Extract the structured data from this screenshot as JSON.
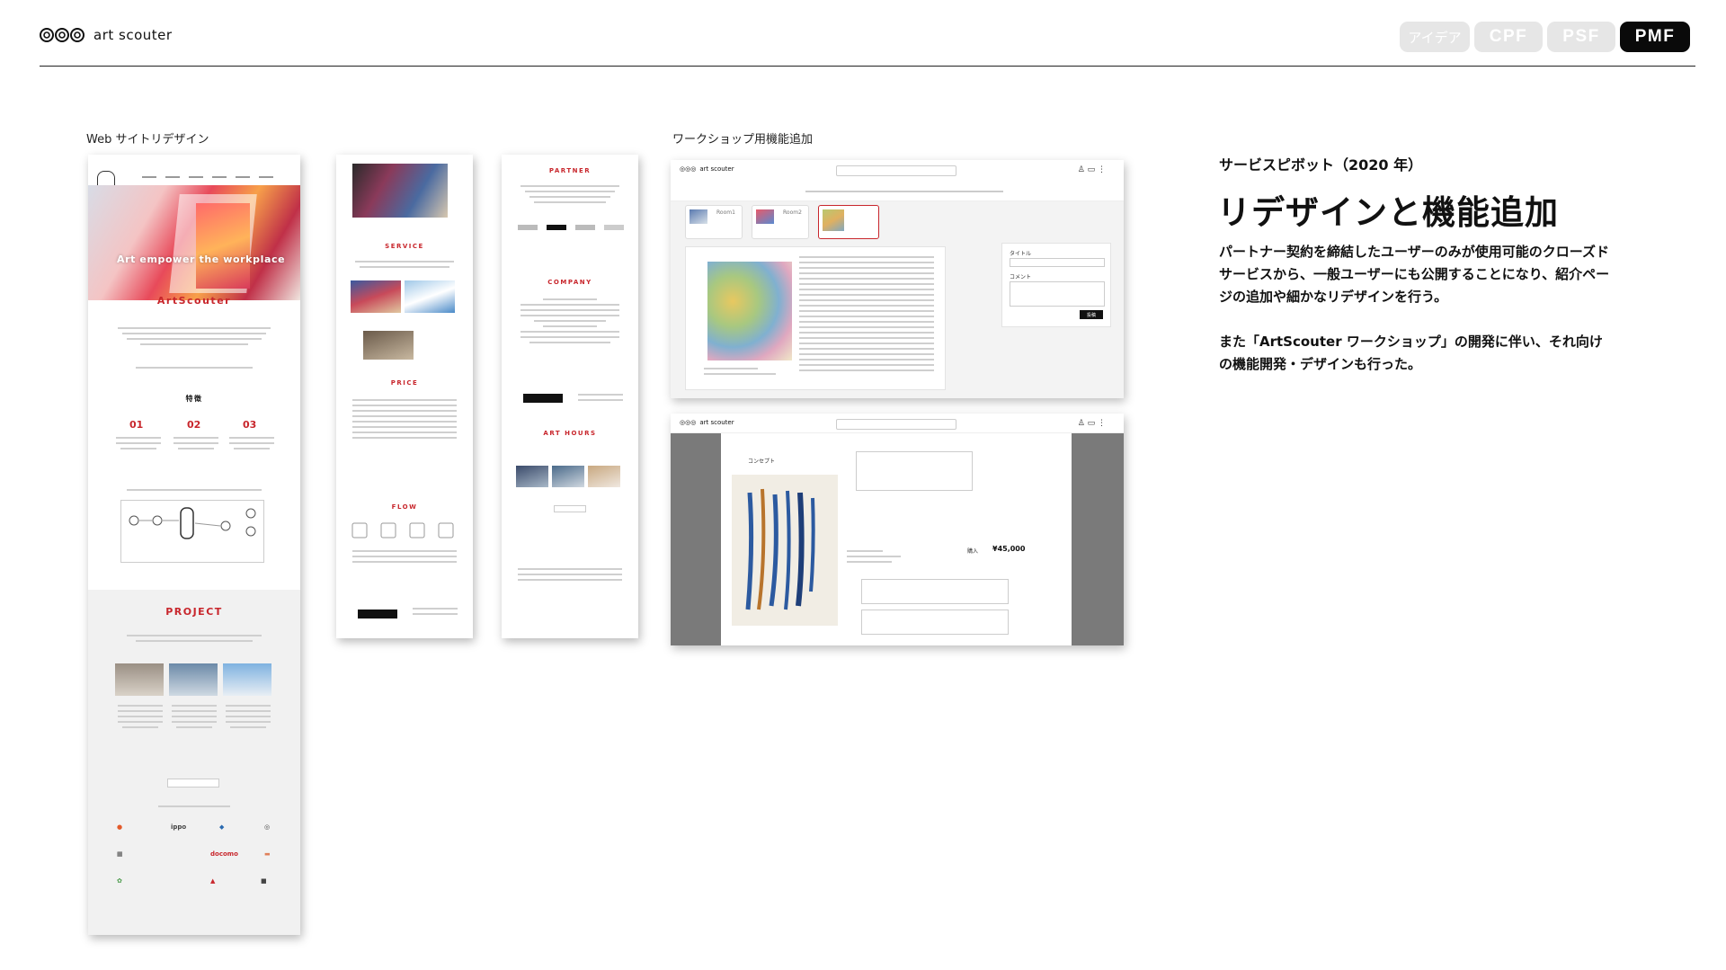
{
  "header": {
    "logo_text": "art scouter",
    "stages": [
      {
        "label": "アイデア",
        "active": false
      },
      {
        "label": "CPF",
        "active": false
      },
      {
        "label": "PSF",
        "active": false
      },
      {
        "label": "PMF",
        "active": true
      }
    ]
  },
  "left_section": {
    "label": "Web サイトリデザイン",
    "hero_text": "Art empower the workplace",
    "brand_title": "ArtScouter",
    "features_title": "特徴",
    "feature_numbers": [
      "01",
      "02",
      "03"
    ],
    "project_title": "PROJECT",
    "service_title": "SERVICE",
    "price_title": "PRICE",
    "flow_title": "FLOW",
    "partner_title": "PARTNER",
    "company_title": "COMPANY",
    "art_hours_title": "ART HOURS",
    "partner_logos": [
      "ippo",
      "docomo"
    ]
  },
  "middle_section": {
    "label": "ワークショップ用機能追加",
    "screen1": {
      "logo_text": "art scouter",
      "rooms": [
        "Room1",
        "Room2"
      ],
      "panel_title_label": "タイトル",
      "panel_comment_label": "コメント",
      "submit_label": "投稿"
    },
    "screen2": {
      "logo_text": "art scouter",
      "concept_label": "コンセプト",
      "price_label": "購入",
      "price": "¥45,000"
    }
  },
  "right_section": {
    "kicker": "サービスピボット（2020 年）",
    "headline": "リデザインと機能追加",
    "paragraph1": "パートナー契約を締結したユーザーのみが使用可能のクローズドサービスから、一般ユーザーにも公開することになり、紹介ページの追加や細かなリデザインを行う。",
    "paragraph2": "また「ArtScouter ワークショップ」の開発に伴い、それ向けの機能開発・デザインも行った。"
  },
  "colors": {
    "accent": "#c8262c",
    "stage_inactive": "#e6e6e6",
    "stage_active": "#0a0a0a"
  }
}
